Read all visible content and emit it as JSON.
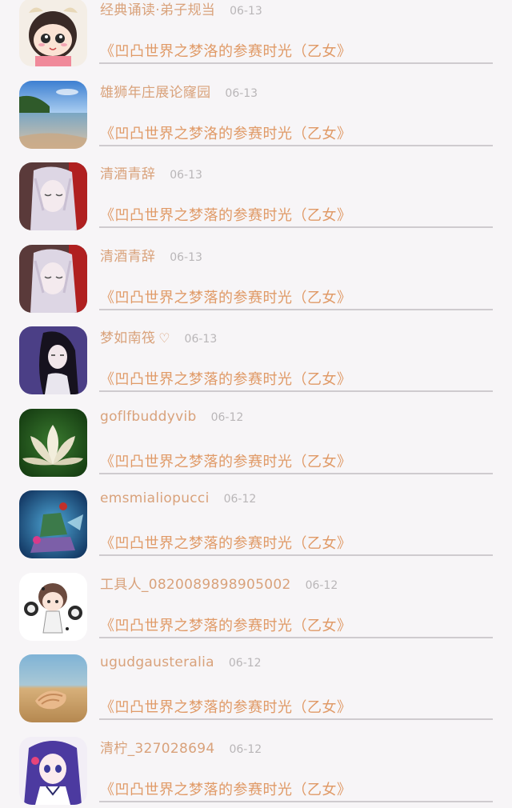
{
  "items": [
    {
      "name": "经典诵读·弟子规当",
      "heart": "",
      "date": "06-13",
      "title": "《凹凸世界之梦洛的参赛时光（乙女》",
      "avatar_icon": "cartoon-girl-cow-hat"
    },
    {
      "name": "雄狮年庄展论窿园",
      "heart": "",
      "date": "06-13",
      "title": "《凹凸世界之梦洛的参赛时光（乙女》",
      "avatar_icon": "beach-landscape"
    },
    {
      "name": "清酒青辞",
      "heart": "",
      "date": "06-13",
      "title": "《凹凸世界之梦落的参赛时光（乙女》",
      "avatar_icon": "anime-silver-hair"
    },
    {
      "name": "清酒青辞",
      "heart": "",
      "date": "06-13",
      "title": "《凹凸世界之梦落的参赛时光（乙女》",
      "avatar_icon": "anime-silver-hair"
    },
    {
      "name": "梦如南筏",
      "heart": "♡",
      "date": "06-13",
      "title": "《凹凸世界之梦落的参赛时光（乙女》",
      "avatar_icon": "anime-dark-hair"
    },
    {
      "name": "goflfbuddyvib",
      "heart": "",
      "date": "06-12",
      "title": "《凹凸世界之梦落的参赛时光（乙女》",
      "avatar_icon": "lotus-flower"
    },
    {
      "name": "emsmialiopucci",
      "heart": "",
      "date": "06-12",
      "title": "《凹凸世界之梦落的参赛时光（乙女》",
      "avatar_icon": "game-character"
    },
    {
      "name": "工具人_0820089898905002",
      "heart": "",
      "date": "06-12",
      "title": "《凹凸世界之梦落的参赛时光（乙女》",
      "avatar_icon": "cartoon-boy-cookies"
    },
    {
      "name": "ugudgausteralia",
      "heart": "",
      "date": "06-12",
      "title": "《凹凸世界之梦落的参赛时光（乙女》",
      "avatar_icon": "seashell-beach"
    },
    {
      "name": "清柠_327028694",
      "heart": "",
      "date": "06-12",
      "title": "《凹凸世界之梦落的参赛时光（乙女》",
      "avatar_icon": "anime-purple-hair"
    }
  ],
  "colors": {
    "background": "#f7f5f7",
    "name": "#d9a27b",
    "title": "#e09a67",
    "date": "#b9b6b8",
    "divider": "#cfcbcf"
  }
}
